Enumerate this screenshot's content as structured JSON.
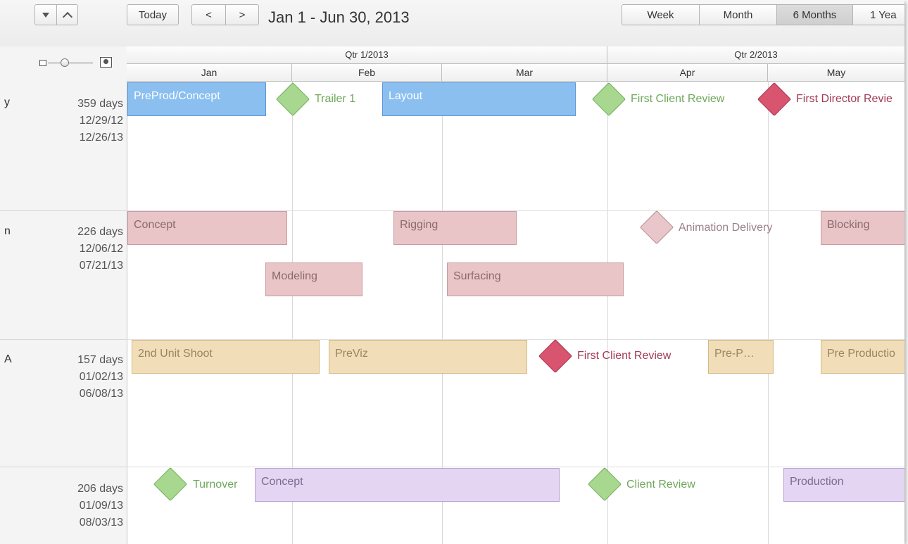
{
  "toolbar": {
    "today_label": "Today",
    "prev_label": "<",
    "next_label": ">",
    "date_range": "Jan 1 - Jun 30, 2013",
    "views": [
      "Week",
      "Month",
      "6 Months",
      "1 Yea"
    ],
    "active_view": "6 Months"
  },
  "timeline": {
    "quarters": [
      "Qtr 1/2013",
      "Qtr 2/2013"
    ],
    "months": [
      "Jan",
      "Feb",
      "Mar",
      "Apr",
      "May"
    ]
  },
  "rows": [
    {
      "edge_char": "y",
      "duration": "359 days",
      "start": "12/29/12",
      "end": "12/26/13",
      "bars": [
        {
          "label": "PreProd/Concept",
          "color": "blue"
        },
        {
          "label": "Layout",
          "color": "blue"
        }
      ],
      "milestones": [
        {
          "label": "Trailer 1",
          "color": "green"
        },
        {
          "label": "First Client Review",
          "color": "green"
        },
        {
          "label": "First Director Revie",
          "color": "red"
        }
      ]
    },
    {
      "edge_char": "n",
      "duration": "226 days",
      "start": "12/06/12",
      "end": "07/21/13",
      "bars": [
        {
          "label": "Concept",
          "color": "pink"
        },
        {
          "label": "Rigging",
          "color": "pink"
        },
        {
          "label": "Blocking",
          "color": "pink"
        },
        {
          "label": "Modeling",
          "color": "pink"
        },
        {
          "label": "Surfacing",
          "color": "pink"
        }
      ],
      "milestones": [
        {
          "label": "Animation Delivery",
          "color": "pink"
        }
      ]
    },
    {
      "edge_char": "A",
      "duration": "157 days",
      "start": "01/02/13",
      "end": "06/08/13",
      "bars": [
        {
          "label": "2nd Unit Shoot",
          "color": "tan"
        },
        {
          "label": "PreViz",
          "color": "tan"
        },
        {
          "label": "Pre-P…",
          "color": "tan"
        },
        {
          "label": "Pre Productio",
          "color": "tan"
        }
      ],
      "milestones": [
        {
          "label": "First Client Review",
          "color": "red"
        }
      ]
    },
    {
      "edge_char": "",
      "duration": "206 days",
      "start": "01/09/13",
      "end": "08/03/13",
      "bars": [
        {
          "label": "Concept",
          "color": "purple"
        },
        {
          "label": "Production",
          "color": "purple"
        }
      ],
      "milestones": [
        {
          "label": "Turnover",
          "color": "green"
        },
        {
          "label": "Client Review",
          "color": "green"
        }
      ]
    }
  ],
  "colors": {
    "blue_bar": "#8bbff0",
    "pink_bar": "#e9c5c8",
    "tan_bar": "#f1ddb7",
    "purple_bar": "#e4d6f2",
    "milestone_green": "#a8d88f",
    "milestone_red": "#d9546f",
    "milestone_pink": "#e8c6c9"
  },
  "icons": [
    "arrow-down-icon",
    "chevron-up-icon",
    "zoom-small-icon",
    "zoom-large-icon"
  ]
}
